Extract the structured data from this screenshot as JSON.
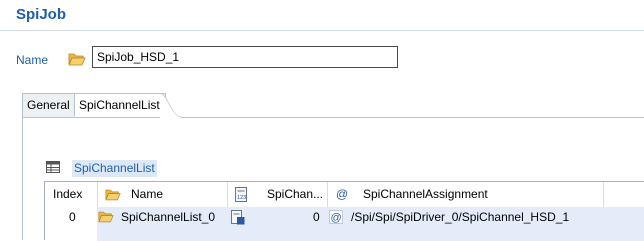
{
  "header": {
    "title": "SpiJob"
  },
  "name_field": {
    "label": "Name",
    "value": "SpiJob_HSD_1",
    "icon": "folder-open-icon"
  },
  "tabs": [
    {
      "label": "General",
      "active": false
    },
    {
      "label": "SpiChannelList",
      "active": true
    }
  ],
  "section": {
    "title": "SpiChannelList",
    "icon": "table-icon"
  },
  "table": {
    "columns": [
      {
        "label": "Index",
        "icon": ""
      },
      {
        "label": "Name",
        "icon": "folder-open-icon"
      },
      {
        "label": "SpiChan...",
        "icon": "numeric-field-icon"
      },
      {
        "label": "SpiChannelAssignment",
        "icon": "reference-icon"
      }
    ],
    "rows": [
      {
        "index": "0",
        "name": "SpiChannelList_0",
        "spichan": "0",
        "assignment": "/Spi/Spi/SpiDriver_0/SpiChannel_HSD_1"
      }
    ]
  },
  "colors": {
    "accent": "#1f5faa",
    "selection": "#e4ecf9",
    "section_highlight": "#dde8f6"
  }
}
